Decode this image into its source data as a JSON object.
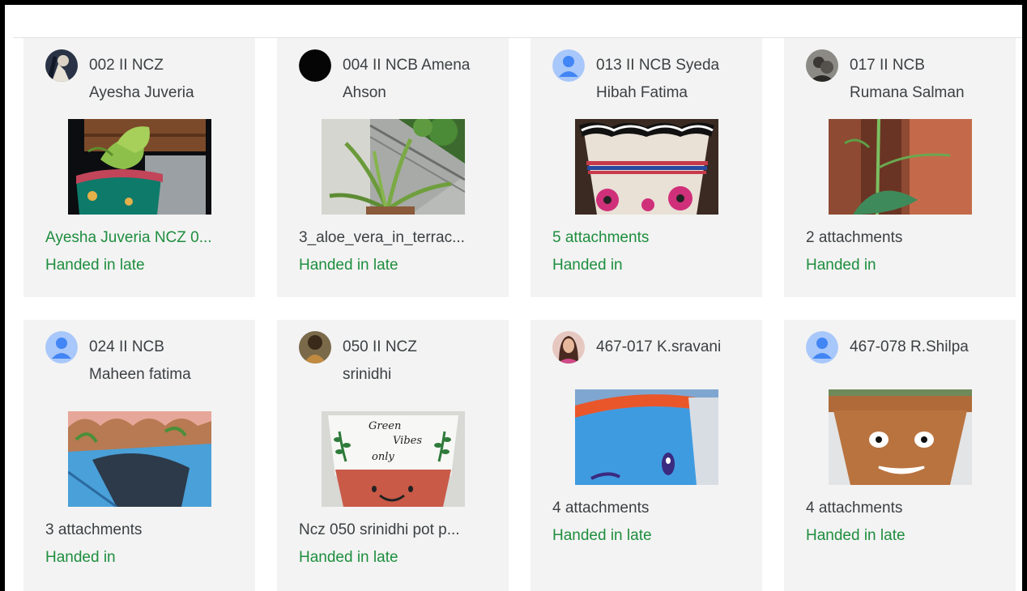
{
  "cards": [
    {
      "name": "002 II NCZ\nAyesha Juveria",
      "attachment": "Ayesha Juveria NCZ 0...",
      "status": "Handed in late",
      "avatar_icon": "profile-photo",
      "thumb_icon": "money-plant-pot-photo"
    },
    {
      "name": "004 II NCB Amena\nAhson",
      "attachment": "3_aloe_vera_in_terrac...",
      "status": "Handed in late",
      "avatar_icon": "black-circle-photo",
      "thumb_icon": "aloe-vera-photo"
    },
    {
      "name": "013 II NCB Syeda\nHibah Fatima",
      "attachment": "5 attachments",
      "status": "Handed in",
      "avatar_icon": "default-person-icon",
      "thumb_icon": "painted-pot-photo"
    },
    {
      "name": "017 II NCB\nRumana Salman",
      "attachment": "2 attachments",
      "status": "Handed in",
      "avatar_icon": "profile-photo",
      "thumb_icon": "plant-photo"
    },
    {
      "name": "024 II NCB\nMaheen fatima",
      "attachment": "3 attachments",
      "status": "Handed in",
      "avatar_icon": "default-person-icon",
      "thumb_icon": "blue-painted-pot-photo"
    },
    {
      "name": "050 II NCZ\nsrinidhi",
      "attachment": "Ncz 050 srinidhi pot p...",
      "status": "Handed in late",
      "avatar_icon": "profile-photo",
      "thumb_icon": "green-vibes-pot-photo",
      "thumb_text": [
        "Green",
        "Vibes",
        "only"
      ]
    },
    {
      "name": "467-017 K.sravani",
      "attachment": "4 attachments",
      "status": "Handed in late",
      "avatar_icon": "profile-photo",
      "thumb_icon": "blue-face-pot-photo"
    },
    {
      "name": "467-078 R.Shilpa",
      "attachment": "4 attachments",
      "status": "Handed in late",
      "avatar_icon": "default-person-icon",
      "thumb_icon": "smiley-pot-photo"
    }
  ],
  "colors": {
    "late": "#1e8e3e",
    "text": "#3c4043",
    "card": "#f3f3f3",
    "avatar_blue": "#a8c7fa"
  }
}
